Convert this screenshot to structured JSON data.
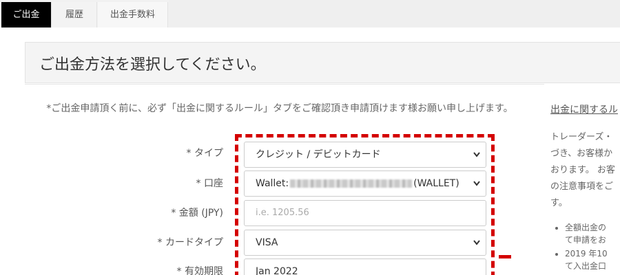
{
  "tabs": [
    {
      "label": "ご出金",
      "active": true
    },
    {
      "label": "履歴",
      "active": false
    },
    {
      "label": "出金手数料",
      "active": false
    }
  ],
  "heading": "ご出金方法を選択してください。",
  "notice": "*ご出金申請頂く前に、必ず「出金に関するルール」タブをご確認頂き申請頂けます様お願い申し上げます。",
  "form": {
    "type": {
      "label": "* タイプ",
      "value": "クレジット / デビットカード"
    },
    "account": {
      "label": "* 口座",
      "prefix": "Wallet:",
      "suffix": "(WALLET)"
    },
    "amount": {
      "label": "* 金額 (JPY)",
      "placeholder": "i.e. 1205.56"
    },
    "card_type": {
      "label": "* カードタイプ",
      "value": "VISA"
    },
    "expiry": {
      "label": "* 有効期限",
      "value": "Jan 2022"
    }
  },
  "side": {
    "title": "出金に関するル",
    "para_lines": [
      "トレーダーズ・",
      "づき、お客様か",
      "おります。 お客",
      "の注意事項をご",
      "す。"
    ],
    "bullets": [
      {
        "line1": "全額出金の",
        "line2": "て申請をお"
      },
      {
        "line1": "2019 年10",
        "line2": "て入出金口"
      }
    ]
  },
  "colors": {
    "accent_active_tab": "#000000",
    "highlight_dash": "#d40000"
  }
}
